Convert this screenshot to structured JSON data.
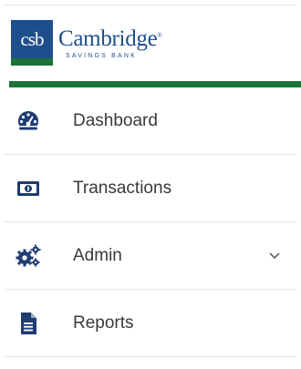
{
  "brand": {
    "logo_mark": "csb",
    "name": "Cambridge",
    "trademark": "®",
    "subtitle": "SAVINGS BANK",
    "colors": {
      "blue": "#1f4e8c",
      "green": "#1c7339"
    }
  },
  "nav": {
    "items": [
      {
        "label": "Dashboard",
        "icon": "dashboard-icon"
      },
      {
        "label": "Transactions",
        "icon": "money-bill-icon"
      },
      {
        "label": "Admin",
        "icon": "gears-icon",
        "has_submenu": true
      },
      {
        "label": "Reports",
        "icon": "document-icon"
      }
    ],
    "icon_color": "#1f3c73",
    "text_color": "#3a3a3a"
  }
}
